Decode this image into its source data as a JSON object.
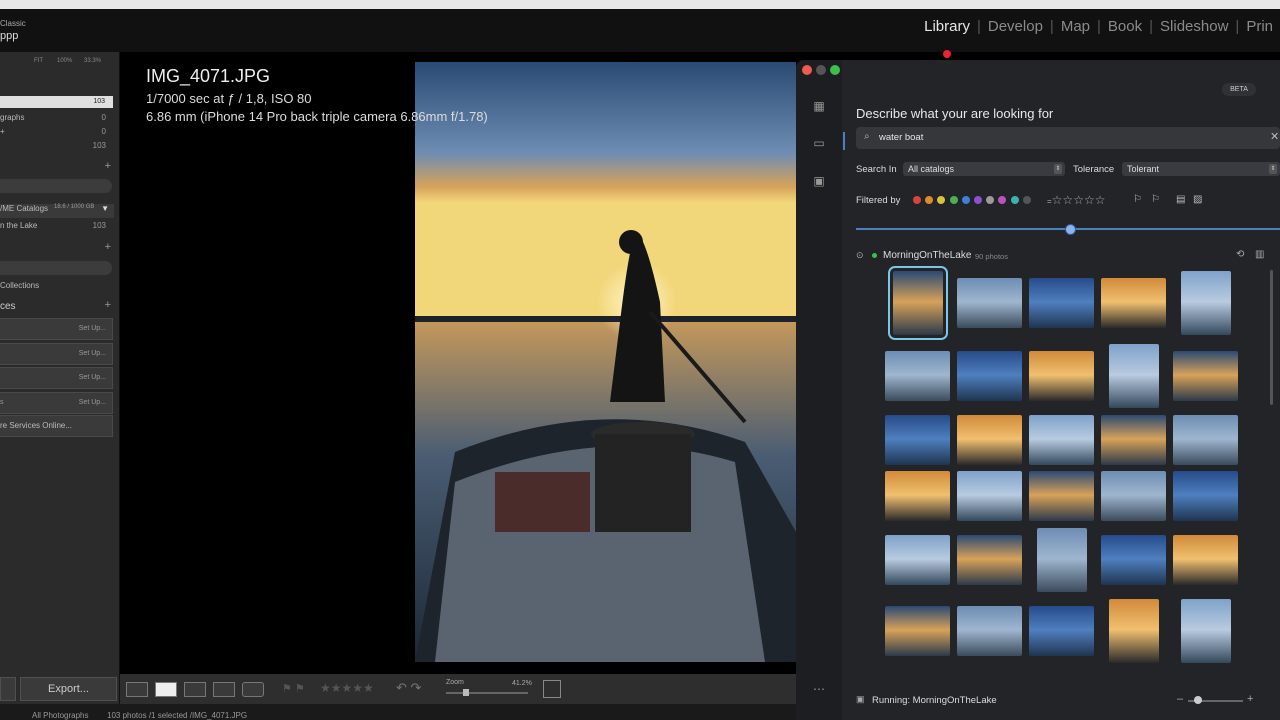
{
  "app": {
    "brand_top": "Classic",
    "brand_bottom": "ppp"
  },
  "module_picker": {
    "items": [
      "Library",
      "Develop",
      "Map",
      "Book",
      "Slideshow",
      "Prin"
    ],
    "active": "Library"
  },
  "left_panel": {
    "nav_zoom": {
      "fit": "FIT",
      "z100": "100%",
      "z33": "33.3%"
    },
    "catalog_rows": [
      {
        "label": "",
        "count": "103"
      },
      {
        "label": "graphs",
        "count": "0"
      },
      {
        "label": "+",
        "count": "0"
      },
      {
        "label": "",
        "count": "103"
      }
    ],
    "folders": [
      {
        "label": "/ME Catalogs",
        "info": "18.6 / 1000 GB"
      },
      {
        "label": "n the Lake",
        "count": "103"
      }
    ],
    "collections_label": "Collections",
    "publish_header": "ces",
    "publish_services": [
      {
        "label": "",
        "action": "Set Up..."
      },
      {
        "label": "",
        "action": "Set Up..."
      },
      {
        "label": "",
        "action": "Set Up..."
      },
      {
        "label": "s",
        "action": "Set Up..."
      }
    ],
    "find_more": "re Services Online..."
  },
  "photo_info": {
    "filename": "IMG_4071.JPG",
    "exposure": "1/7000 sec at ƒ / 1,8, ISO 80",
    "lens": "6.86 mm (iPhone 14 Pro back triple camera 6.86mm f/1.78)"
  },
  "toolbar": {
    "export": "Export...",
    "zoom_label": "Zoom",
    "zoom_value": "41.2%"
  },
  "bottom_bar": {
    "source": "All Photographs",
    "status": "103 photos /1 selected /IMG_4071.JPG"
  },
  "ai_panel": {
    "beta": "BETA",
    "prompt_label": "Describe what your are looking for",
    "search_value": "water boat",
    "search_in_label": "Search In",
    "search_in_value": "All catalogs",
    "tolerance_label": "Tolerance",
    "tolerance_value": "Tolerant",
    "filtered_by_label": "Filtered by",
    "color_labels": [
      "#d8443c",
      "#e08a2a",
      "#d8c23a",
      "#4caf50",
      "#3f7fd8",
      "#8e4fd0",
      "#9b9b9b",
      "#c050c0",
      "#3fb0b0",
      "#555555"
    ],
    "stars": "☆☆☆☆☆",
    "slider_value": 0.5,
    "collection_name": "MorningOnTheLake",
    "collection_count": "90 photos",
    "status": "Running: MorningOnTheLake"
  },
  "colors": {
    "accent": "#4b7fc0",
    "panel_bg": "#232427",
    "status_green": "#3cbf4f"
  }
}
